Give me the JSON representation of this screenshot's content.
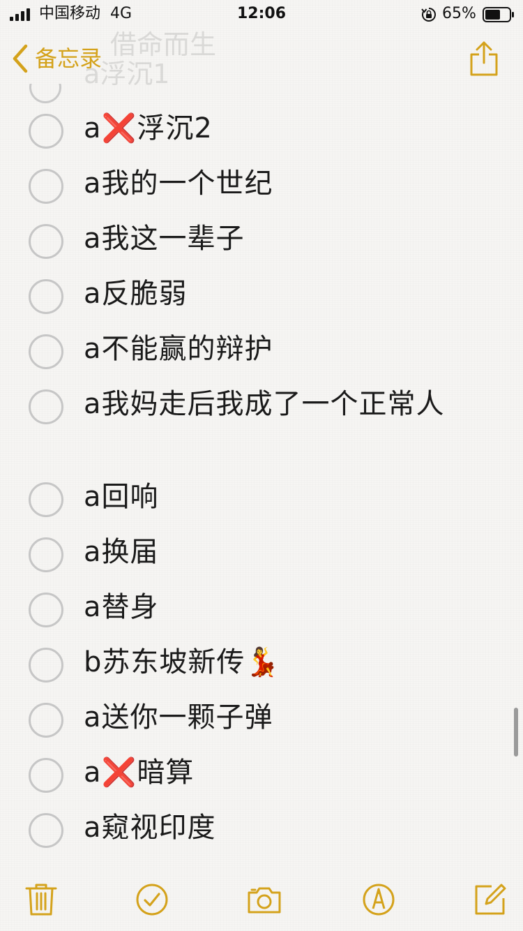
{
  "status_bar": {
    "carrier": "中国移动",
    "network": "4G",
    "time": "12:06",
    "battery_percent": "65%",
    "signal_icon": "signal-bars-icon",
    "lock_icon": "orientation-lock-icon",
    "battery_icon": "battery-icon",
    "battery_level": 0.65
  },
  "nav": {
    "back_label": "备忘录",
    "back_icon": "chevron-left-icon",
    "share_icon": "share-icon",
    "faded_title": "借命而生",
    "faded_item": "a浮沉1"
  },
  "checklist": {
    "items": [
      {
        "text": "a❌浮沉2",
        "checked": false
      },
      {
        "text": "a我的一个世纪",
        "checked": false
      },
      {
        "text": "a我这一辈子",
        "checked": false
      },
      {
        "text": "a反脆弱",
        "checked": false
      },
      {
        "text": "a不能赢的辩护",
        "checked": false
      },
      {
        "text": "a我妈走后我成了一个正常人",
        "checked": false
      },
      {
        "text": "a回响",
        "checked": false
      },
      {
        "text": "a换届",
        "checked": false
      },
      {
        "text": "a替身",
        "checked": false
      },
      {
        "text": "b苏东坡新传💃",
        "checked": false
      },
      {
        "text": "a送你一颗子弹",
        "checked": false
      },
      {
        "text": "a❌暗算",
        "checked": false
      },
      {
        "text": "a窥视印度",
        "checked": false
      }
    ]
  },
  "toolbar": {
    "icons": [
      "trash-icon",
      "checklist-icon",
      "camera-icon",
      "markup-pen-icon",
      "compose-icon"
    ]
  },
  "colors": {
    "accent": "#d4a21b",
    "circle": "#c6c6c6",
    "background": "#f6f5f3",
    "text": "#1a1a1a"
  }
}
